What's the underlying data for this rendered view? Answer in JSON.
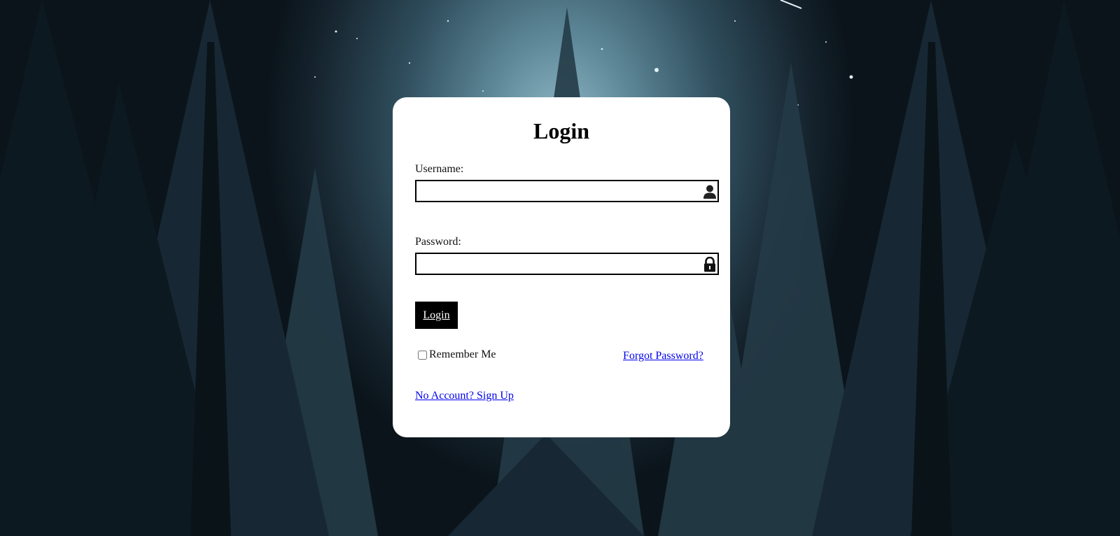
{
  "page": {
    "background": "night-forest-sky"
  },
  "login": {
    "title": "Login",
    "username_label": "Username:",
    "username_value": "",
    "username_icon": "user-icon",
    "password_label": "Password:",
    "password_value": "",
    "password_icon": "lock-icon",
    "submit_label": "Login",
    "remember_label": "Remember Me",
    "remember_checked": false,
    "forgot_link": "Forgot Password?",
    "signup_link": "No Account? Sign Up"
  },
  "colors": {
    "card": "#ffffff",
    "button": "#000000",
    "link": "#0000ee"
  }
}
